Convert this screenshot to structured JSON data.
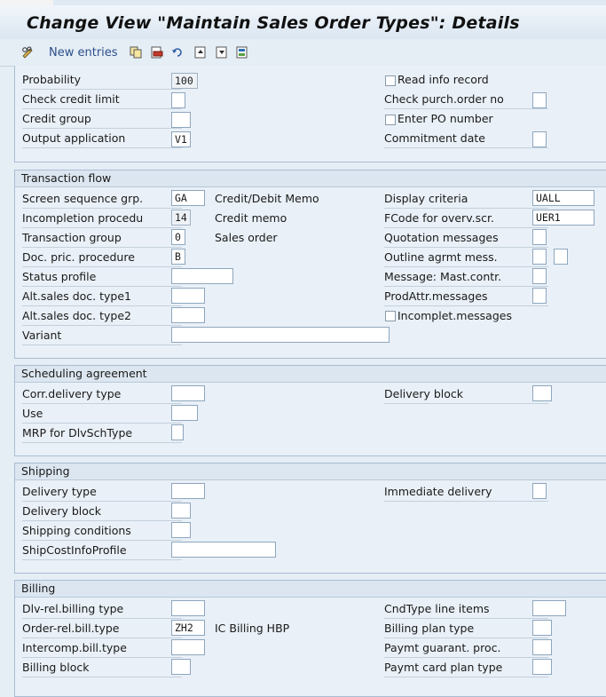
{
  "window": {
    "title": "Change View \"Maintain Sales Order Types\": Details"
  },
  "toolbar": {
    "new_entries_label": "New entries",
    "icons": [
      "copy-icon",
      "delete-icon",
      "undo-icon",
      "previous-entry-icon",
      "next-entry-icon",
      "select-icon"
    ]
  },
  "general": {
    "probability_label": "Probability",
    "probability_value": "100",
    "check_credit_limit_label": "Check credit limit",
    "check_credit_limit_value": "",
    "credit_group_label": "Credit group",
    "credit_group_value": "",
    "output_application_label": "Output application",
    "output_application_value": "V1",
    "read_info_record_label": "Read info record",
    "check_purch_order_label": "Check purch.order no",
    "check_purch_order_value": "",
    "enter_po_number_label": "Enter PO number",
    "commitment_date_label": "Commitment  date",
    "commitment_date_value": ""
  },
  "transaction_flow": {
    "title": "Transaction flow",
    "screen_seq_label": "Screen sequence grp.",
    "screen_seq_value": "GA",
    "screen_seq_desc": "Credit/Debit Memo",
    "incompletion_label": "Incompletion procedu",
    "incompletion_value": "14",
    "incompletion_desc": "Credit memo",
    "transaction_group_label": "Transaction group",
    "transaction_group_value": "0",
    "transaction_group_desc": "Sales order",
    "doc_pric_label": "Doc. pric. procedure",
    "doc_pric_value": "B",
    "status_profile_label": "Status profile",
    "status_profile_value": "",
    "alt_type1_label": "Alt.sales doc. type1",
    "alt_type1_value": "",
    "alt_type2_label": "Alt.sales doc. type2",
    "alt_type2_value": "",
    "variant_label": "Variant",
    "variant_value": "",
    "display_criteria_label": "Display criteria",
    "display_criteria_value": "UALL",
    "fcode_label": "FCode for overv.scr.",
    "fcode_value": "UER1",
    "quotation_messages_label": "Quotation messages",
    "quotation_messages_value": "",
    "outline_agrmt_label": "Outline agrmt mess.",
    "outline_agrmt_value": "",
    "outline_agrmt_value2": "",
    "message_mast_label": "Message: Mast.contr.",
    "message_mast_value": "",
    "prodattr_label": "ProdAttr.messages",
    "prodattr_value": "",
    "incomplet_messages_label": "Incomplet.messages"
  },
  "scheduling": {
    "title": "Scheduling agreement",
    "corr_delivery_label": "Corr.delivery type",
    "corr_delivery_value": "",
    "use_label": "Use",
    "use_value": "",
    "mrp_label": "MRP for DlvSchType",
    "mrp_value": "",
    "delivery_block_label": "Delivery block",
    "delivery_block_value": ""
  },
  "shipping": {
    "title": "Shipping",
    "delivery_type_label": "Delivery type",
    "delivery_type_value": "",
    "delivery_block_label": "Delivery block",
    "delivery_block_value": "",
    "shipping_conditions_label": "Shipping conditions",
    "shipping_conditions_value": "",
    "shipcost_label": "ShipCostInfoProfile",
    "shipcost_value": "",
    "immediate_delivery_label": "Immediate delivery",
    "immediate_delivery_value": ""
  },
  "billing": {
    "title": "Billing",
    "dlv_rel_label": "Dlv-rel.billing type",
    "dlv_rel_value": "",
    "order_rel_label": "Order-rel.bill.type",
    "order_rel_value": "ZH2",
    "order_rel_desc": "IC Billing HBP",
    "intercomp_label": "Intercomp.bill.type",
    "intercomp_value": "",
    "billing_block_label": "Billing block",
    "billing_block_value": "",
    "cndtype_label": "CndType line items",
    "cndtype_value": "",
    "billing_plan_label": "Billing plan type",
    "billing_plan_value": "",
    "paymt_guarant_label": "Paymt guarant. proc.",
    "paymt_guarant_value": "",
    "paymt_card_label": "Paymt card plan type",
    "paymt_card_value": ""
  }
}
